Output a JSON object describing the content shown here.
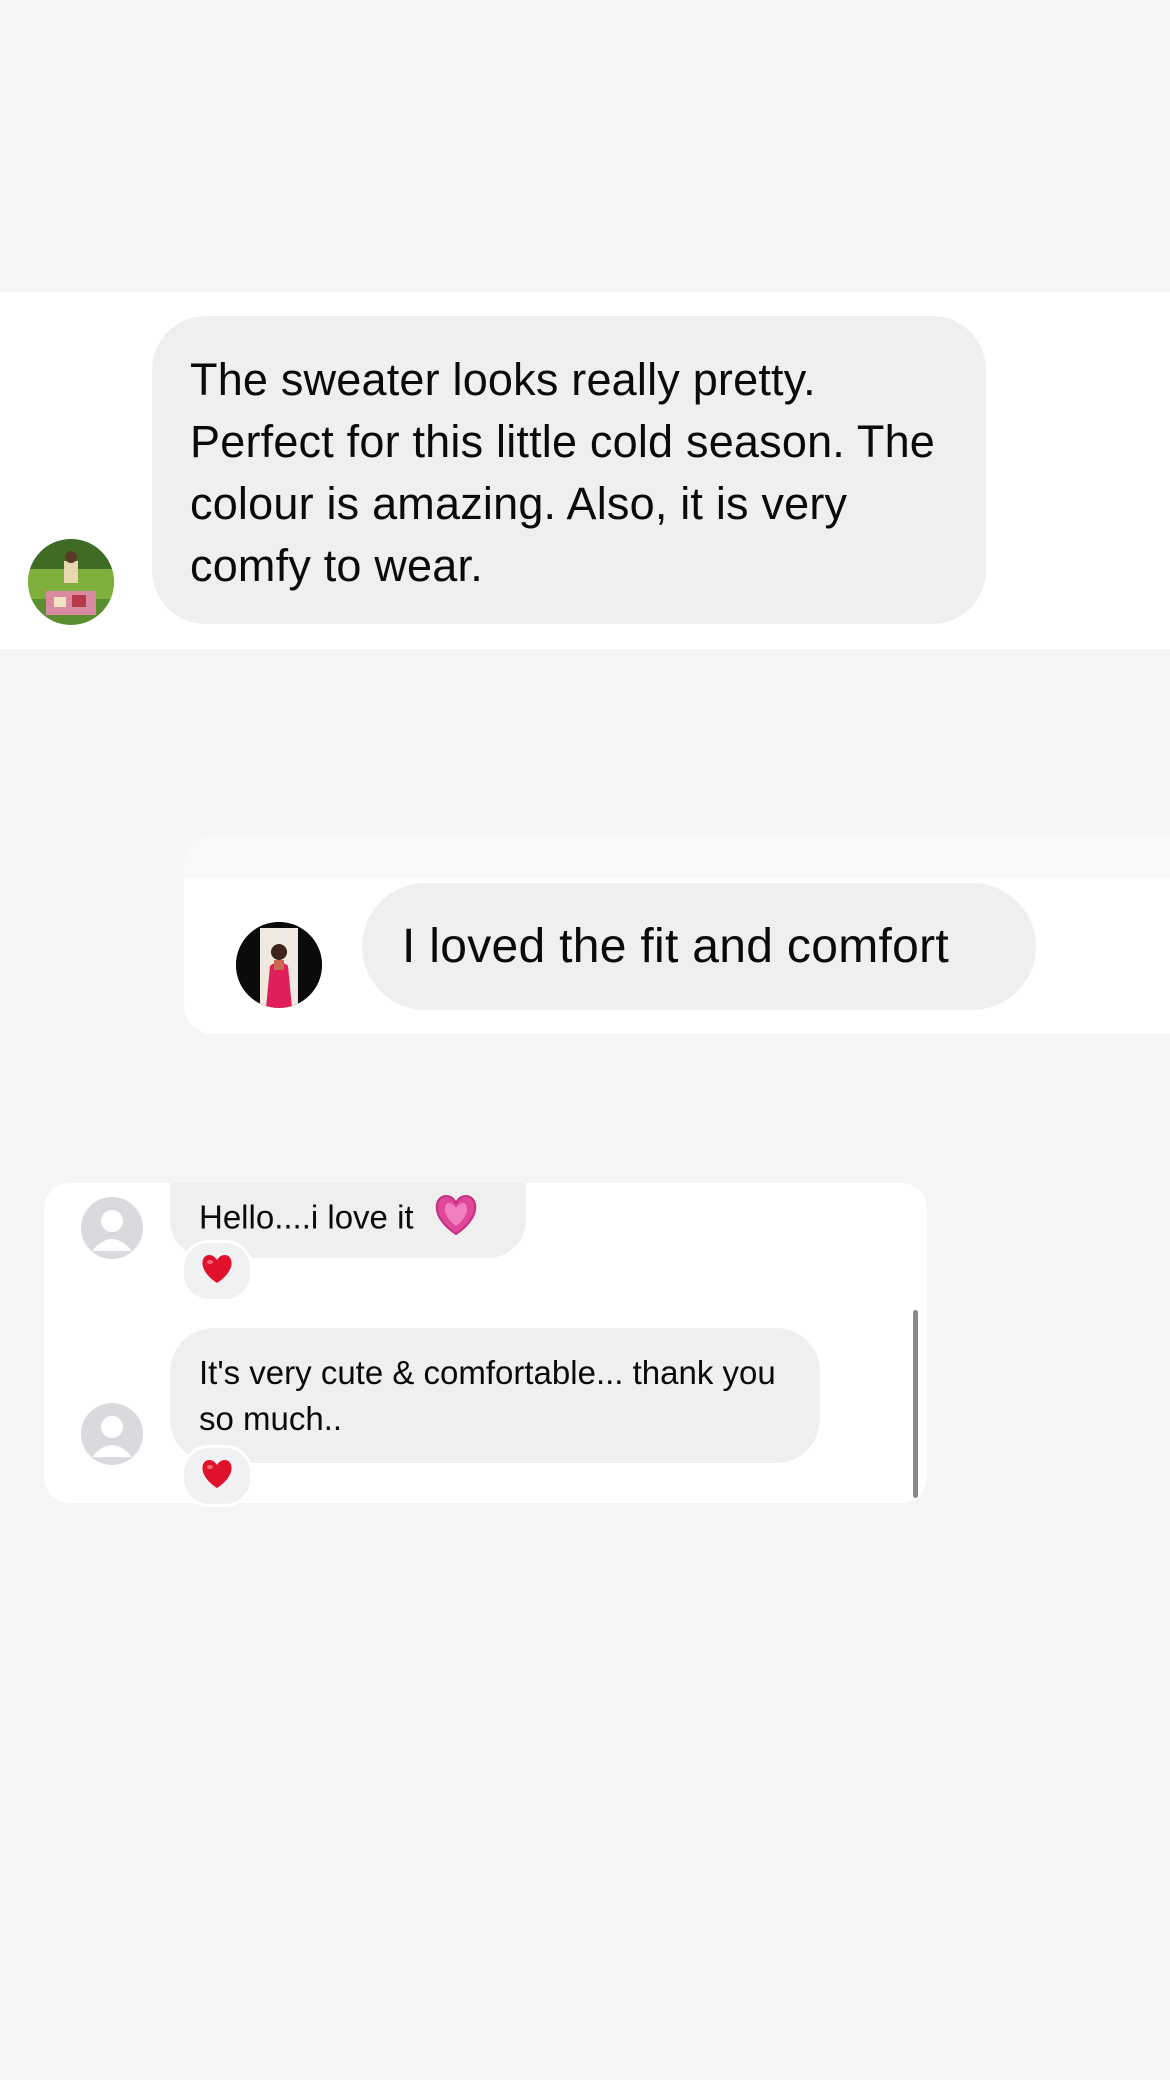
{
  "comments": {
    "first": {
      "text": "The sweater looks really pretty. Perfect for this little cold season. The colour is amazing. Also, it is very comfy to wear.",
      "avatar_icon": "user-photo-avatar"
    },
    "second": {
      "text": "I loved the fit and comfort",
      "avatar_icon": "user-photo-avatar"
    },
    "thread": [
      {
        "text": "Hello....i love it",
        "emoji_icon": "pink-heart-icon",
        "reaction_icon": "red-heart-icon",
        "avatar_icon": "default-user-avatar"
      },
      {
        "text": "It's very cute & comfortable... thank you so much..",
        "reaction_icon": "red-heart-icon",
        "avatar_icon": "default-user-avatar"
      }
    ]
  },
  "colors": {
    "background": "#f5f5f5",
    "card": "#ffffff",
    "bubble": "#efeff0",
    "heart_red": "#e0112b",
    "heart_pink": "#e0479b"
  }
}
